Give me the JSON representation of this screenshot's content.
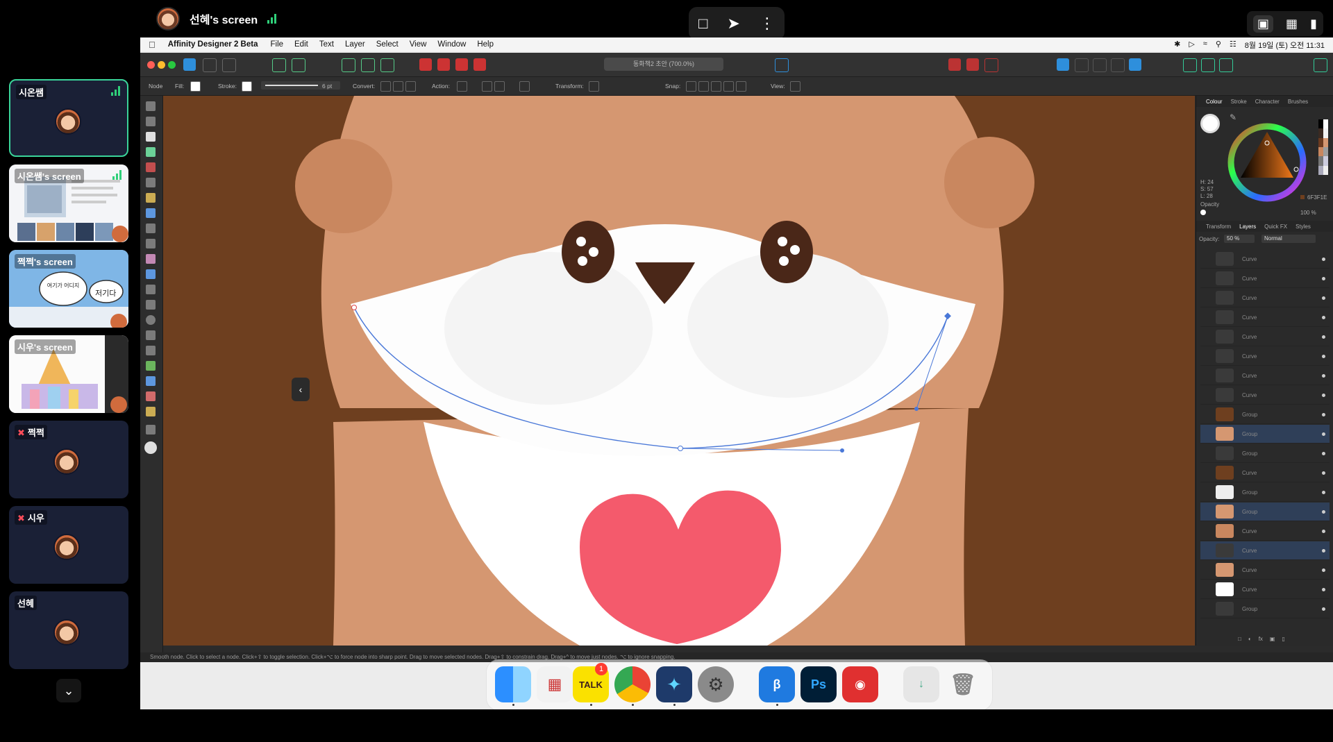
{
  "meeting": {
    "presenter_name": "선혜's screen",
    "participants": [
      {
        "name": "시온쌤",
        "type": "camera"
      },
      {
        "name": "시온쌤's screen",
        "type": "screen"
      },
      {
        "name": "쩍쩍's screen",
        "type": "screen",
        "bubble_left": "여기가 어디지",
        "bubble_right": "저기다"
      },
      {
        "name": "시우's screen",
        "type": "screen"
      },
      {
        "name": "쩍쩍",
        "type": "camera",
        "muted": true
      },
      {
        "name": "시우",
        "type": "camera",
        "muted": true
      },
      {
        "name": "선혜",
        "type": "camera"
      }
    ]
  },
  "menubar": {
    "app_name": "Affinity Designer 2 Beta",
    "items": [
      "File",
      "Edit",
      "Text",
      "Layer",
      "Select",
      "View",
      "Window",
      "Help"
    ],
    "datetime": "8월 19일 (토) 오전 11:31"
  },
  "toolbar": {
    "document_title": "동화책2 초안 (700.0%)"
  },
  "context_toolbar": {
    "mode": "Node",
    "fill_label": "Fill:",
    "stroke_label": "Stroke:",
    "stroke_width": "6 pt",
    "convert_label": "Convert:",
    "action_label": "Action:",
    "transform_label": "Transform:",
    "snap_label": "Snap:",
    "view_label": "View:"
  },
  "colour_panel": {
    "tabs": [
      "Colour",
      "Stroke",
      "Character",
      "Brushes"
    ],
    "active_tab": "Colour",
    "h": "H: 24",
    "s": "S: 57",
    "l": "L: 28",
    "opacity_label": "Opacity",
    "opacity_value": "100 %",
    "hex": "6F3F1E",
    "current_color": "#6F3F1E"
  },
  "layers_panel": {
    "tabs": [
      "Transform",
      "Layers",
      "Quick FX",
      "Styles"
    ],
    "active_tab": "Layers",
    "opacity_label": "Opacity:",
    "opacity_value": "50 %",
    "blend_mode": "Normal",
    "layers": [
      {
        "name": "Curve",
        "selected": false
      },
      {
        "name": "Curve",
        "selected": false
      },
      {
        "name": "Curve",
        "selected": false
      },
      {
        "name": "Curve",
        "selected": false
      },
      {
        "name": "Curve",
        "selected": false
      },
      {
        "name": "Curve",
        "selected": false
      },
      {
        "name": "Curve",
        "selected": false
      },
      {
        "name": "Curve",
        "selected": false
      },
      {
        "name": "Group",
        "selected": false
      },
      {
        "name": "Group",
        "selected": true
      },
      {
        "name": "Group",
        "selected": false
      },
      {
        "name": "Curve",
        "selected": false
      },
      {
        "name": "Group",
        "selected": false
      },
      {
        "name": "Group",
        "selected": true
      },
      {
        "name": "Curve",
        "selected": false
      },
      {
        "name": "Curve",
        "selected": true
      },
      {
        "name": "Curve",
        "selected": false
      },
      {
        "name": "Curve",
        "selected": false
      },
      {
        "name": "Group",
        "selected": false
      }
    ]
  },
  "status_bar": "Smooth node. Click to select a node. Click+⇧ to toggle selection. Click+⌥ to force node into sharp point. Drag to move selected nodes. Drag+⇧ to constrain drag. Drag+^ to move just nodes. ⌥ to ignore snapping.",
  "dock": {
    "apps": [
      "Finder",
      "Launchpad",
      "KakaoTalk",
      "Chrome",
      "Designer",
      "System Settings",
      "Affinity Designer 2 Beta",
      "Photoshop",
      "Photo Booth",
      "Downloads",
      "Trash"
    ],
    "kakaotalk_label": "TALK",
    "kakaotalk_badge": "1",
    "photoshop_label": "Ps"
  }
}
